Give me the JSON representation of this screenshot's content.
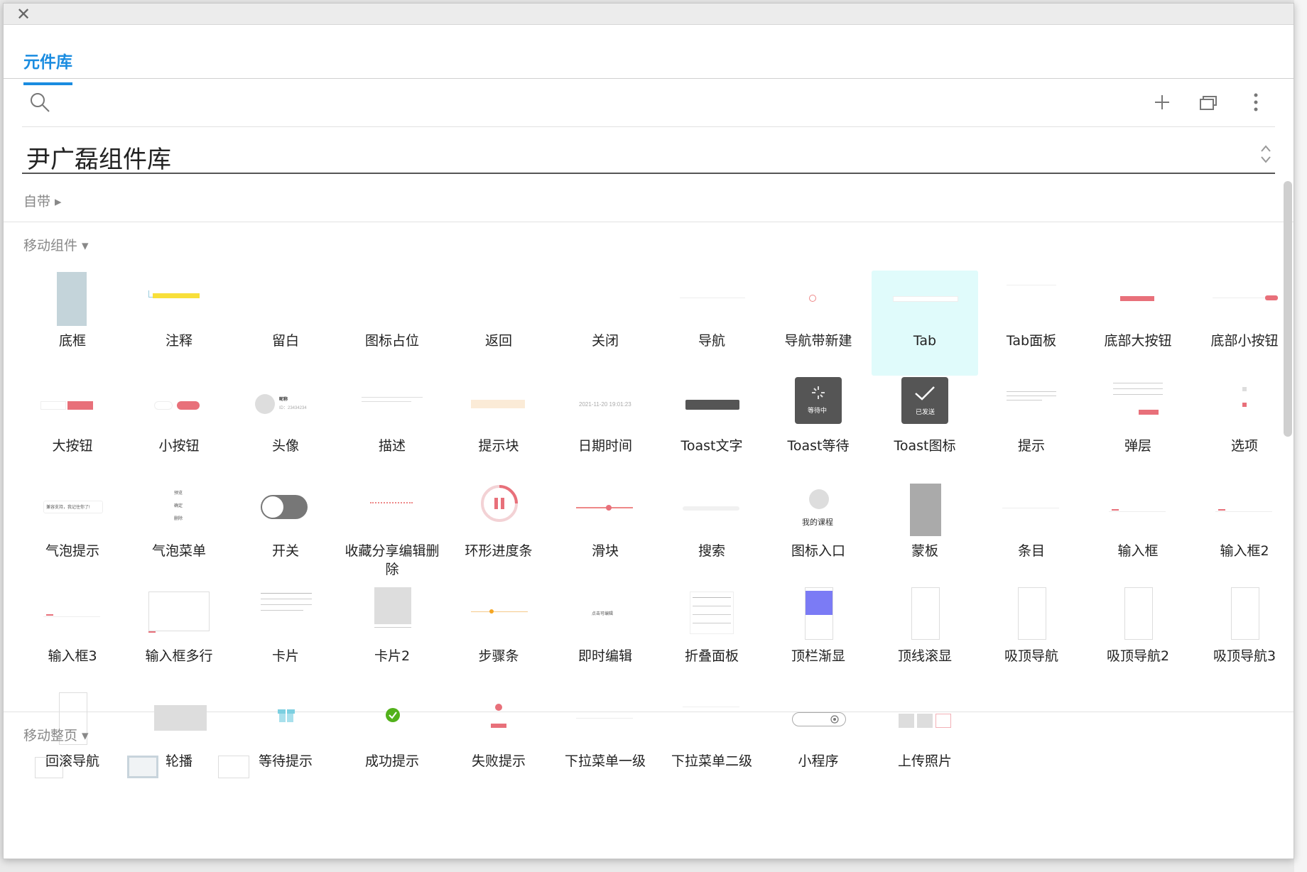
{
  "window": {
    "close_glyph": "✕"
  },
  "tabs": [
    {
      "label": "元件库"
    }
  ],
  "toolbar": {
    "icons": [
      "search-icon",
      "add-icon",
      "windows-icon",
      "more-icon"
    ]
  },
  "library": {
    "name": "尹广磊组件库"
  },
  "sections": {
    "own": {
      "title": "自带 ▸"
    },
    "mobile": {
      "title": "移动组件 ▾"
    },
    "page": {
      "title": "移动整页 ▾"
    }
  },
  "accent_color": "#1a8ce0",
  "selected_color": "#e0fbfb",
  "components": [
    "底框",
    "注释",
    "留白",
    "图标占位",
    "返回",
    "关闭",
    "导航",
    "导航带新建",
    "Tab",
    "Tab面板",
    "底部大按钮",
    "底部小按钮",
    "大按钮",
    "小按钮",
    "头像",
    "描述",
    "提示块",
    "日期时间",
    "Toast文字",
    "Toast等待",
    "Toast图标",
    "提示",
    "弹层",
    "选项",
    "气泡提示",
    "气泡菜单",
    "开关",
    "收藏分享编辑删除",
    "环形进度条",
    "滑块",
    "搜索",
    "图标入口",
    "蒙板",
    "条目",
    "输入框",
    "输入框2",
    "输入框3",
    "输入框多行",
    "卡片",
    "卡片2",
    "步骤条",
    "即时编辑",
    "折叠面板",
    "顶栏渐显",
    "顶线滚显",
    "吸顶导航",
    "吸顶导航2",
    "吸顶导航3",
    "回滚导航",
    "轮播",
    "等待提示",
    "成功提示",
    "失败提示",
    "下拉菜单一级",
    "下拉菜单二级",
    "小程序",
    "上传照片"
  ],
  "selected_index": 8,
  "thumb_text": {
    "avatar_name": "昵称",
    "avatar_id": "ID：23434234",
    "datetime": "2021-11-20 19:01:23",
    "toast_wait": "等待中",
    "toast_icon": "已发送",
    "bubble": "兼容支持，我记住你了!",
    "bubble_menu": [
      "预览",
      "确定",
      "删除"
    ],
    "icon_entry": "我的课程",
    "inline_edit": "点击可编辑"
  }
}
